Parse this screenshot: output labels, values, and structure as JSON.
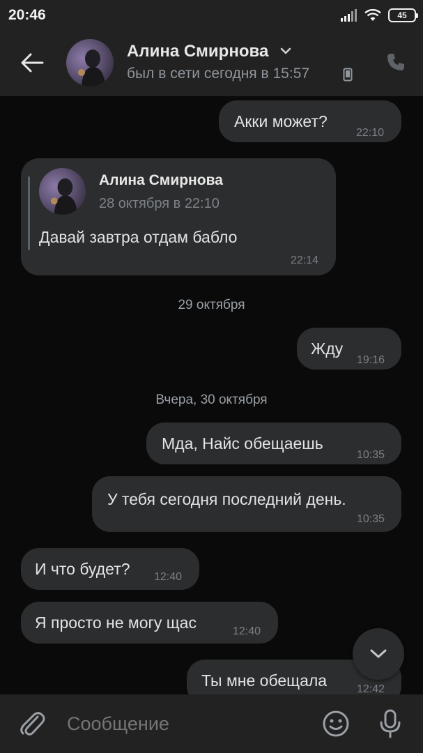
{
  "status_bar": {
    "time": "20:46",
    "battery": "45"
  },
  "header": {
    "contact_name": "Алина Смирнова",
    "status": "был в сети сегодня в 15:57"
  },
  "messages": {
    "m1": {
      "text": "Акки может?",
      "time": "22:10"
    },
    "forwarded": {
      "author": "Алина Смирнова",
      "date": "28 октября в 22:10",
      "text": "Давай завтра отдам бабло",
      "time": "22:14"
    },
    "sep1": "29 октября",
    "m2": {
      "text": "Жду",
      "time": "19:16"
    },
    "sep2": "Вчера, 30 октября",
    "m3": {
      "text": "Мда, Найс обещаешь",
      "time": "10:35"
    },
    "m4": {
      "text": "У тебя сегодня последний день.",
      "time": "10:35"
    },
    "m5": {
      "text": "И что будет?",
      "time": "12:40"
    },
    "m6": {
      "text": "Я просто не могу щас",
      "time": "12:40"
    },
    "m7": {
      "text": "Ты мне обещала",
      "time": "12:42"
    }
  },
  "composer": {
    "placeholder": "Сообщение"
  },
  "icons": {
    "back": "arrow-left-icon",
    "chevron": "chevron-down-icon",
    "mobile": "mobile-phone-icon",
    "call": "phone-icon",
    "scroll_down": "chevron-down-icon",
    "attach": "paperclip-icon",
    "emoji": "smile-icon",
    "mic": "microphone-icon"
  },
  "colors": {
    "background": "#0a0a0a",
    "bars": "#222222",
    "bubble": "#2c2d2e",
    "text": "#e1e3e6",
    "muted": "#8f959c"
  }
}
